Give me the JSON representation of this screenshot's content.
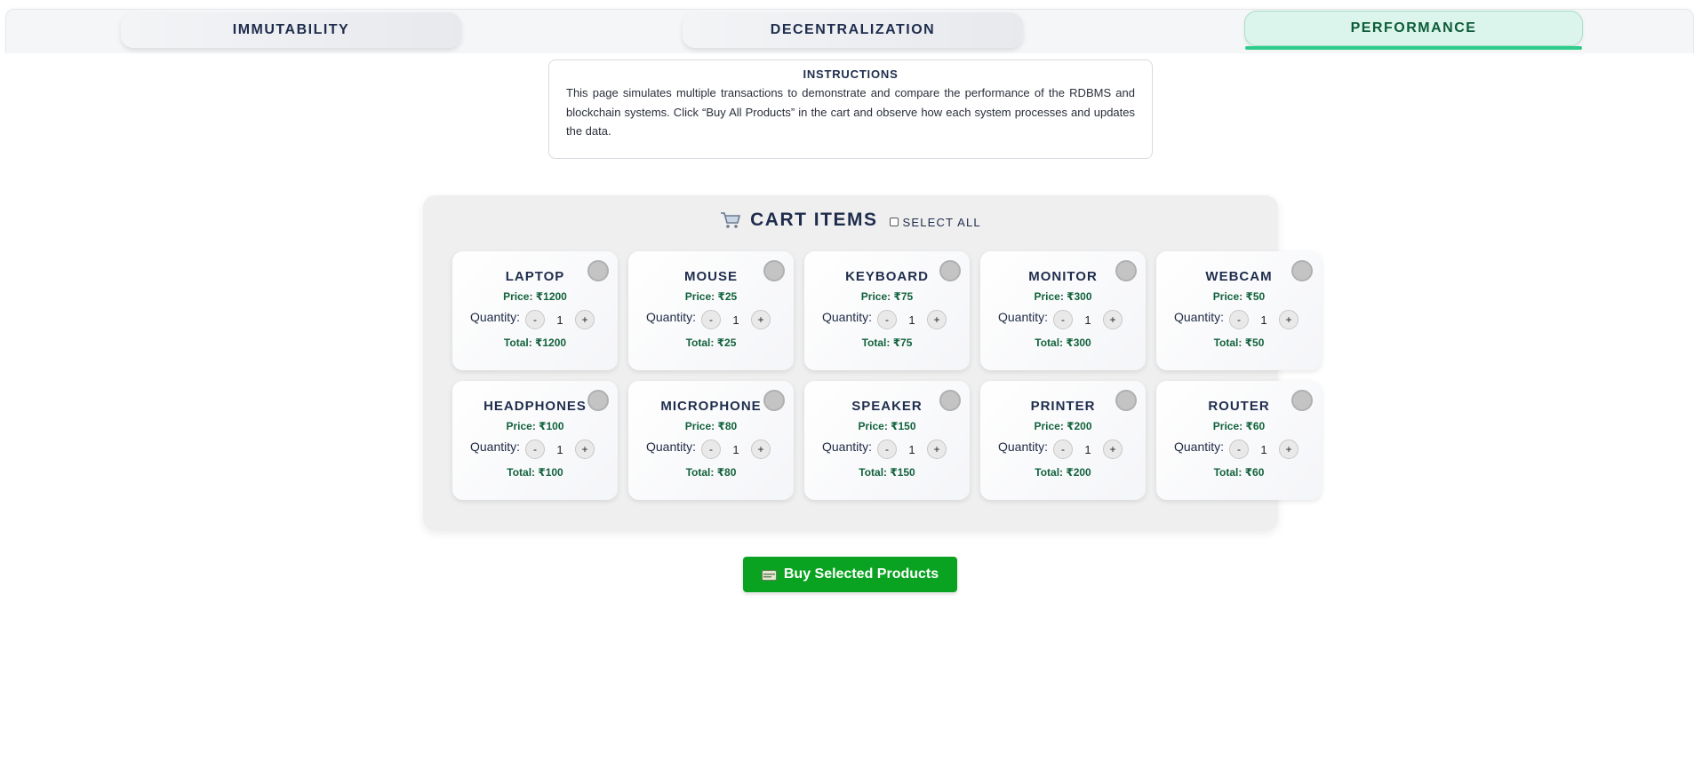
{
  "tabs": [
    {
      "label": "IMMUTABILITY"
    },
    {
      "label": "DECENTRALIZATION"
    },
    {
      "label": "PERFORMANCE",
      "active": true
    }
  ],
  "instructions": {
    "title": "INSTRUCTIONS",
    "text": "This page simulates multiple transactions to demonstrate and compare the performance of the RDBMS and blockchain systems. Click “Buy All Products” in the cart and observe how each system processes and updates the data."
  },
  "cart": {
    "title": "CART ITEMS",
    "icon": "shopping-cart-icon",
    "select_all_label": "SELECT ALL",
    "quantity_label": "Quantity:",
    "minus": "-",
    "plus": "+",
    "items": [
      {
        "name": "LAPTOP",
        "price": "Price: ₹1200",
        "qty": "1",
        "total": "Total: ₹1200"
      },
      {
        "name": "MOUSE",
        "price": "Price: ₹25",
        "qty": "1",
        "total": "Total: ₹25"
      },
      {
        "name": "KEYBOARD",
        "price": "Price: ₹75",
        "qty": "1",
        "total": "Total: ₹75"
      },
      {
        "name": "MONITOR",
        "price": "Price: ₹300",
        "qty": "1",
        "total": "Total: ₹300"
      },
      {
        "name": "WEBCAM",
        "price": "Price: ₹50",
        "qty": "1",
        "total": "Total: ₹50"
      },
      {
        "name": "HEADPHONES",
        "price": "Price: ₹100",
        "qty": "1",
        "total": "Total: ₹100"
      },
      {
        "name": "MICROPHONE",
        "price": "Price: ₹80",
        "qty": "1",
        "total": "Total: ₹80"
      },
      {
        "name": "SPEAKER",
        "price": "Price: ₹150",
        "qty": "1",
        "total": "Total: ₹150"
      },
      {
        "name": "PRINTER",
        "price": "Price: ₹200",
        "qty": "1",
        "total": "Total: ₹200"
      },
      {
        "name": "ROUTER",
        "price": "Price: ₹60",
        "qty": "1",
        "total": "Total: ₹60"
      }
    ]
  },
  "buy_button": {
    "label": "Buy Selected Products",
    "icon": "money-icon"
  },
  "colors": {
    "accent_green": "#0aa321",
    "active_tab_bg": "#dcf5ec",
    "price_green": "#12623c"
  }
}
